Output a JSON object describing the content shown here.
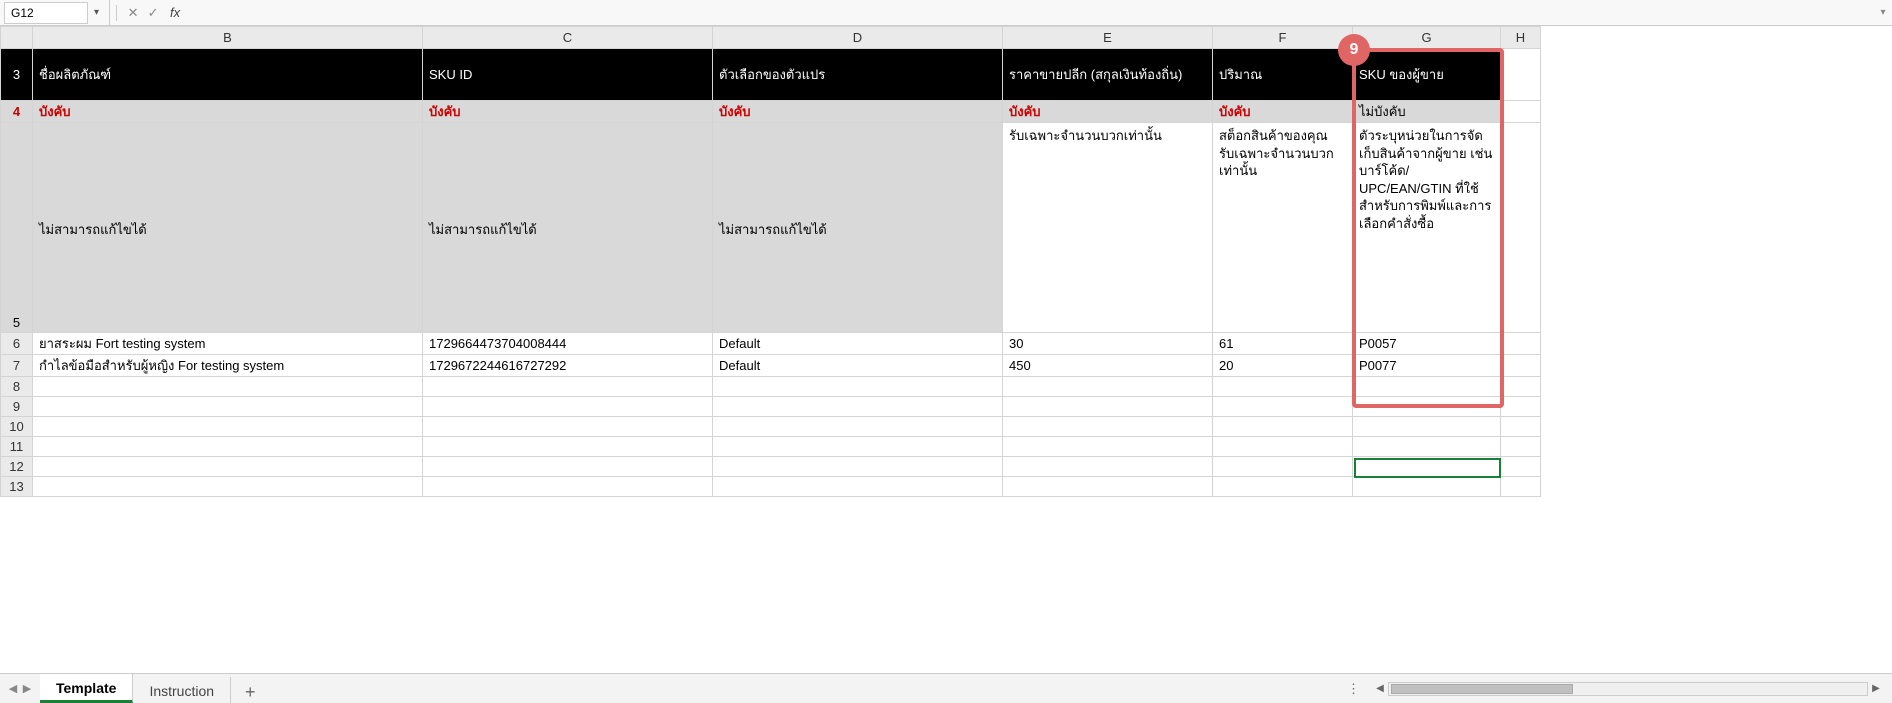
{
  "nameBox": "G12",
  "formula": "",
  "columns": [
    "B",
    "C",
    "D",
    "E",
    "F",
    "G",
    "H"
  ],
  "rowHeads": [
    "3",
    "4",
    "5",
    "6",
    "7",
    "8",
    "9",
    "10",
    "11",
    "12",
    "13"
  ],
  "headerBlack": {
    "B": "ชื่อผลิตภัณฑ์",
    "C": "SKU ID",
    "D": "ตัวเลือกของตัวแปร",
    "E": "ราคาขายปลีก (สกุลเงินท้องถิ่น)",
    "F": "ปริมาณ",
    "G": "SKU ของผู้ขาย"
  },
  "headerReq": {
    "B": "บังคับ",
    "C": "บังคับ",
    "D": "บังคับ",
    "E": "บังคับ",
    "F": "บังคับ",
    "G": "ไม่บังคับ"
  },
  "headerDesc": {
    "B": "ไม่สามารถแก้ไขได้",
    "C": "ไม่สามารถแก้ไขได้",
    "D": "ไม่สามารถแก้ไขได้",
    "E": "รับเฉพาะจำนวนบวกเท่านั้น",
    "F": "สต็อกสินค้าของคุณ รับเฉพาะจำนวนบวกเท่านั้น",
    "G": "ตัวระบุหน่วยในการจัดเก็บสินค้าจากผู้ขาย เช่น บาร์โค้ด/ UPC/EAN/GTIN ที่ใช้สำหรับการพิมพ์และการเลือกคำสั่งซื้อ"
  },
  "rows": [
    {
      "B": "ยาสระผม Fort testing system",
      "C": "1729664473704008444",
      "D": "Default",
      "E": "30",
      "F": "61",
      "G": "P0057"
    },
    {
      "B": "กำไลข้อมือสำหรับผู้หญิง For testing system",
      "C": "1729672244616727292",
      "D": "Default",
      "E": "450",
      "F": "20",
      "G": "P0077"
    }
  ],
  "callout": {
    "number": "9"
  },
  "tabs": {
    "active": "Template",
    "other": "Instruction"
  }
}
